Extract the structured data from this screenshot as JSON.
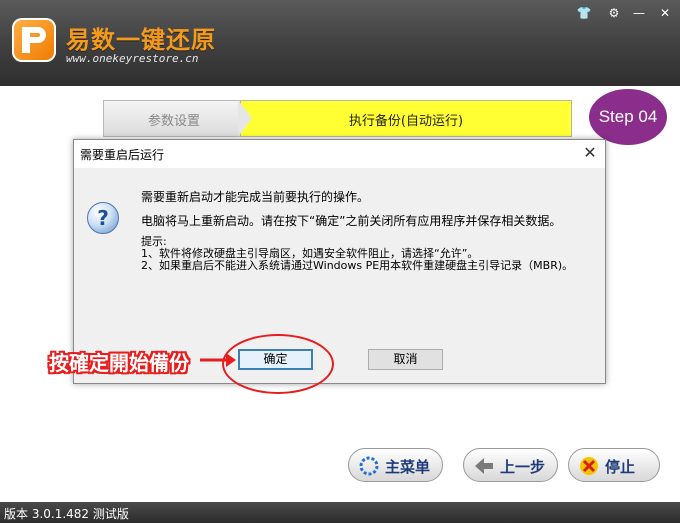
{
  "app": {
    "title": "易数一键还原",
    "url": "www.onekeyrestore.cn",
    "window_controls": {
      "skin": "👕",
      "settings": "⚙",
      "minimize": "—",
      "close": "✕"
    }
  },
  "steps": {
    "previous": "参数设置",
    "current": "执行备份(自动运行)",
    "badge": "Step 04"
  },
  "dialog": {
    "title": "需要重启后运行",
    "close_glyph": "✕",
    "question_glyph": "?",
    "message1": "需要重新启动才能完成当前要执行的操作。",
    "message2": "电脑将马上重新启动。请在按下“确定”之前关闭所有应用程序并保存相关数据。",
    "tips_label": "提示:",
    "tip1": "1、软件将修改硬盘主引导扇区，如遇安全软件阻止，请选择“允许”。",
    "tip2": "2、如果重启后不能进入系统请通过Windows PE用本软件重建硬盘主引导记录（MBR)。",
    "ok_label": "确定",
    "cancel_label": "取消"
  },
  "annotation": {
    "text": "按確定開始備份",
    "color": "#e61e1e"
  },
  "footer_buttons": {
    "main_menu": "主菜单",
    "previous_step": "上一步",
    "stop": "停止"
  },
  "status": {
    "version": "版本 3.0.1.482 测试版"
  },
  "colors": {
    "step_active": "#ffff33",
    "badge": "#8b2d8b",
    "title_accent": "#f39a1d"
  }
}
